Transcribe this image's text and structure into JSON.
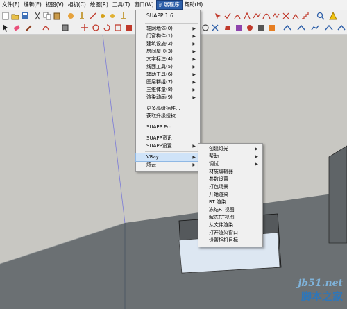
{
  "menubar": {
    "items": [
      "文件(F)",
      "编辑(E)",
      "视图(V)",
      "相机(C)",
      "绘图(R)",
      "工具(T)",
      "窗口(W)",
      "扩展程序",
      "帮助(H)"
    ]
  },
  "suapp_menu": {
    "header": "SUAPP 1.6",
    "groups": [
      [
        {
          "label": "轴网墙体(0)",
          "submenu": true
        },
        {
          "label": "门窗构件(1)",
          "submenu": true
        },
        {
          "label": "建筑设施(2)",
          "submenu": true
        },
        {
          "label": "房间屋顶(3)",
          "submenu": true
        },
        {
          "label": "文字标注(4)",
          "submenu": true
        },
        {
          "label": "线面工具(5)",
          "submenu": true
        },
        {
          "label": "辅助工具(6)",
          "submenu": true
        },
        {
          "label": "图层群组(7)",
          "submenu": true
        },
        {
          "label": "三维体量(8)",
          "submenu": true
        },
        {
          "label": "渲染动画(9)",
          "submenu": true
        }
      ],
      [
        {
          "label": "更多高级插件...",
          "submenu": false
        },
        {
          "label": "获取升级授权...",
          "submenu": false
        }
      ],
      [
        {
          "label": "SUAPP Pro",
          "submenu": false
        }
      ],
      [
        {
          "label": "SUAPP资讯",
          "submenu": false
        },
        {
          "label": "SUAPP设置",
          "submenu": true
        }
      ],
      [
        {
          "label": "VRay",
          "submenu": true,
          "highlighted": true
        },
        {
          "label": "炫云",
          "submenu": true
        }
      ]
    ]
  },
  "vray_menu": {
    "items": [
      {
        "label": "创建灯光",
        "submenu": true
      },
      {
        "label": "帮助",
        "submenu": true
      },
      {
        "label": "调试",
        "submenu": true
      },
      {
        "label": "材质编辑器",
        "submenu": false
      },
      {
        "label": "参数设置",
        "submenu": false
      },
      {
        "label": "打包场景",
        "submenu": false
      },
      {
        "label": "开始渲染",
        "submenu": false
      },
      {
        "label": "RT 渲染",
        "submenu": false
      },
      {
        "label": "冻结RT视图",
        "submenu": false
      },
      {
        "label": "解冻RT视图",
        "submenu": false
      },
      {
        "label": "从文件渲染",
        "submenu": false
      },
      {
        "label": "打开渲染窗口",
        "submenu": false
      },
      {
        "label": "设置相机目标",
        "submenu": false
      }
    ]
  },
  "watermark": {
    "site": "jb51.net",
    "home": "脚本之家"
  },
  "colors": {
    "accent": "#2c5ea8",
    "highlight": "#cfe3f8",
    "ground": "#6b7073",
    "sky": "#c8c7c2"
  }
}
